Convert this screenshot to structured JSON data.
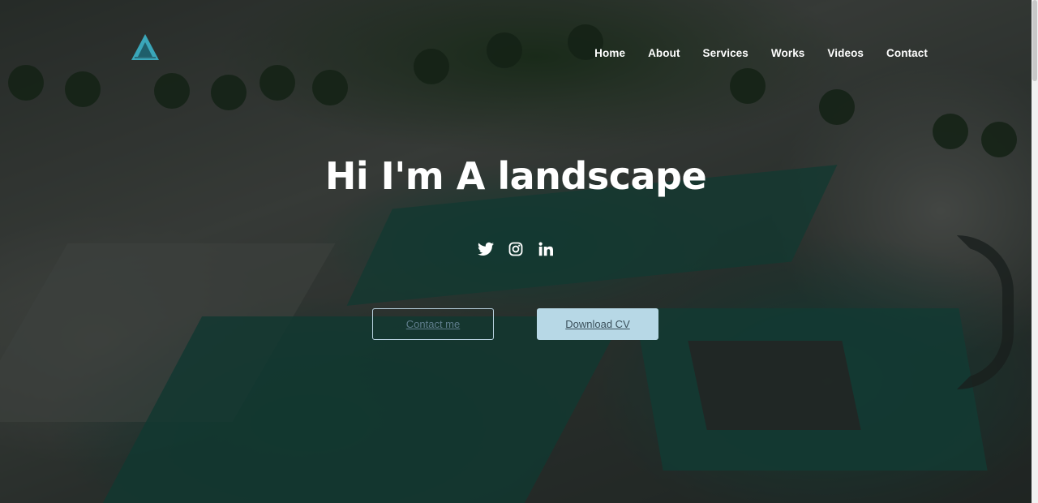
{
  "brand": {
    "logo_icon": "triangle-a-logo-icon",
    "accent": "#3aa6b9"
  },
  "nav": {
    "items": [
      {
        "label": "Home"
      },
      {
        "label": "About"
      },
      {
        "label": "Services"
      },
      {
        "label": "Works"
      },
      {
        "label": "Videos"
      },
      {
        "label": "Contact"
      }
    ]
  },
  "hero": {
    "title": "Hi I'm A landscape",
    "socials": [
      {
        "icon": "twitter-icon"
      },
      {
        "icon": "instagram-icon"
      },
      {
        "icon": "linkedin-icon"
      }
    ],
    "contact_label": "Contact me",
    "cv_label": "Download CV"
  },
  "colors": {
    "button_fill": "#b7d8e6",
    "button_outline": "#b9d3e0"
  }
}
